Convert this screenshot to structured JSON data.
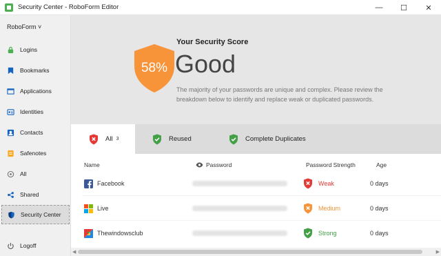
{
  "window": {
    "title": "Security Center - RoboForm Editor",
    "controls": {
      "minimize": "—",
      "maximize": "☐",
      "close": "✕"
    }
  },
  "sidebar": {
    "header": "RoboForm ˅",
    "items": [
      {
        "label": "Logins",
        "icon": "lock-icon",
        "color": "#4caf50"
      },
      {
        "label": "Bookmarks",
        "icon": "bookmark-icon",
        "color": "#1565c0"
      },
      {
        "label": "Applications",
        "icon": "window-icon",
        "color": "#1565c0"
      },
      {
        "label": "Identities",
        "icon": "id-card-icon",
        "color": "#1565c0"
      },
      {
        "label": "Contacts",
        "icon": "contact-icon",
        "color": "#1565c0"
      },
      {
        "label": "Safenotes",
        "icon": "note-icon",
        "color": "#f9a825"
      },
      {
        "label": "All",
        "icon": "all-icon",
        "color": "#777777"
      },
      {
        "label": "Shared",
        "icon": "share-icon",
        "color": "#1565c0"
      },
      {
        "label": "Security Center",
        "icon": "shield-icon",
        "color": "#1565c0",
        "active": true
      }
    ],
    "logoff": "Logoff"
  },
  "score": {
    "title": "Your Security Score",
    "percent": "58%",
    "rating": "Good",
    "description": "The majority of your passwords are unique and complex. Please review the breakdown below to identify and replace weak or duplicated passwords.",
    "shield_color": "#f7943a"
  },
  "tabs": [
    {
      "label": "All",
      "count": "3",
      "icon": "shield-x-icon",
      "color": "#e53935",
      "active": true
    },
    {
      "label": "Reused",
      "icon": "shield-check-icon",
      "color": "#43a047"
    },
    {
      "label": "Complete Duplicates",
      "icon": "shield-check-icon",
      "color": "#43a047"
    }
  ],
  "table": {
    "columns": {
      "name": "Name",
      "password": "Password",
      "strength": "Password Strength",
      "age": "Age"
    },
    "rows": [
      {
        "name": "Facebook",
        "icon": "facebook-icon",
        "strength": "Weak",
        "strength_color": "#e53935",
        "age": "0 days"
      },
      {
        "name": "Live",
        "icon": "windows-icon",
        "strength": "Medium",
        "strength_color": "#f7943a",
        "age": "0 days"
      },
      {
        "name": "Thewindowsclub",
        "icon": "thewindowsclub-icon",
        "strength": "Strong",
        "strength_color": "#43a047",
        "age": "0 days"
      }
    ]
  }
}
